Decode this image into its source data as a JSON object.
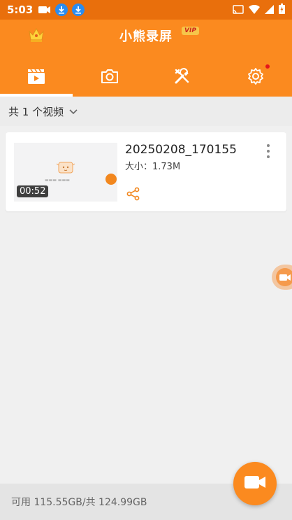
{
  "status_bar": {
    "time": "5:03"
  },
  "app": {
    "title": "小熊录屏",
    "vip_label": "VIP"
  },
  "tabs": [
    {
      "name": "videos"
    },
    {
      "name": "screenshots"
    },
    {
      "name": "tools"
    },
    {
      "name": "settings"
    }
  ],
  "filter": {
    "label": "共 1 个视频"
  },
  "videos": [
    {
      "name": "20250208_170155",
      "size": "大小：1.73M",
      "duration": "00:52"
    }
  ],
  "footer": {
    "storage": "可用 115.55GB/共 124.99GB"
  },
  "colors": {
    "primary": "#fb8a1f",
    "status_bar": "#e96f0c",
    "background": "#f0f0f0"
  }
}
